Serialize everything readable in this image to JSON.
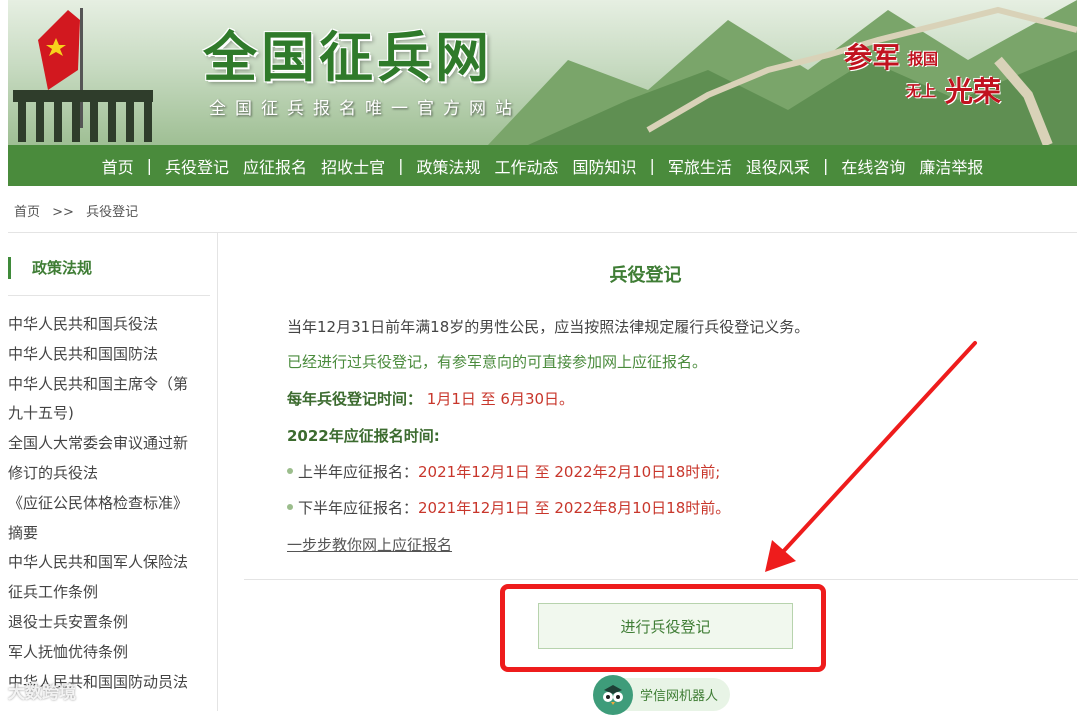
{
  "header": {
    "site_title": "全国征兵网",
    "site_subtitle": "全国征兵报名唯一官方网站",
    "slogan": {
      "part1": "参军",
      "part2": "报国",
      "part3": "无上",
      "part4": "光荣"
    }
  },
  "nav": {
    "items": [
      "首页",
      "兵役登记",
      "应征报名",
      "招收士官",
      "政策法规",
      "工作动态",
      "国防知识",
      "军旅生活",
      "退役风采",
      "在线咨询",
      "廉洁举报"
    ],
    "separator": "|"
  },
  "breadcrumb": {
    "home": "首页",
    "sep": ">>",
    "current": "兵役登记"
  },
  "sidebar": {
    "heading": "政策法规",
    "items": [
      "中华人民共和国兵役法",
      "中华人民共和国国防法",
      "中华人民共和国主席令（第",
      "九十五号)",
      "全国人大常委会审议通过新",
      "修订的兵役法",
      "《应征公民体格检查标准》",
      "摘要",
      "中华人民共和国军人保险法",
      "征兵工作条例",
      "退役士兵安置条例",
      "军人抚恤优待条例",
      "中华人民共和国国防动员法"
    ]
  },
  "main": {
    "title": "兵役登记",
    "para1": "当年12月31日前年满18岁的男性公民，应当按照法律规定履行兵役登记义务。",
    "para2": "已经进行过兵役登记，有参军意向的可直接参加网上应征报名。",
    "reg_time_label": "每年兵役登记时间：",
    "reg_time_value": "1月1日 至 6月30日。",
    "enlist_heading": "2022年应征报名时间:",
    "first_half_label": "上半年应征报名：",
    "first_half_value": "2021年12月1日 至 2022年2月10日18时前;",
    "second_half_label": "下半年应征报名：",
    "second_half_value": "2021年12月1日 至 2022年8月10日18时前。",
    "guide_link": "一步步教你网上应征报名",
    "register_button": "进行兵役登记",
    "robot_label": "学信网机器人"
  },
  "watermark": "大数跨境",
  "colors": {
    "nav_bg": "#4a8b3c",
    "accent_green": "#3f7d35",
    "highlight_red": "#c8362b",
    "annotation_red": "#ee1c1c"
  }
}
